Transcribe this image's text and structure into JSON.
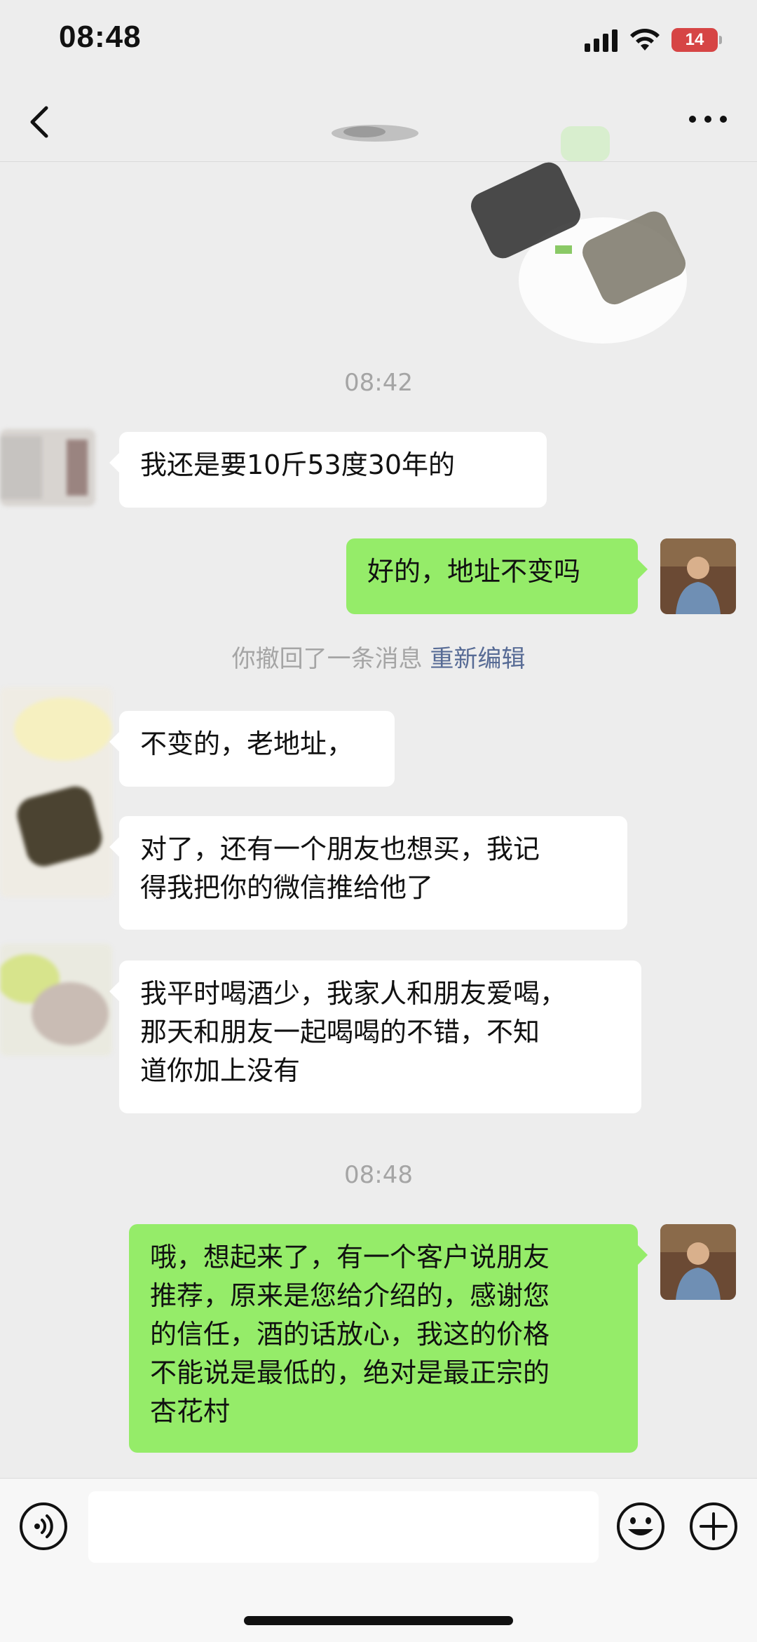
{
  "status_bar": {
    "time": "08:48",
    "battery": "14"
  },
  "icons": {
    "back": "chevron-left-icon",
    "more": "more-dots-icon",
    "voice": "voice-icon",
    "emoji": "emoji-icon",
    "plus": "plus-icon"
  },
  "colors": {
    "sent_bubble": "#95ec69",
    "received_bubble": "#ffffff",
    "link": "#576b95",
    "battery": "#d64545"
  },
  "messages": {
    "ts1": "08:42",
    "m1": "我还是要10斤53度30年的",
    "m2": "好的，地址不变吗",
    "recall_text": "你撤回了一条消息",
    "recall_link": "重新编辑",
    "m3": "不变的，老地址，",
    "m4": "对了，还有一个朋友也想买，我记\n得我把你的微信推给他了",
    "m5": "我平时喝酒少，我家人和朋友爱喝，\n那天和朋友一起喝喝的不错，不知\n道你加上没有",
    "ts2": "08:48",
    "m6": "哦，想起来了，有一个客户说朋友\n推荐，原来是您给介绍的，感谢您\n的信任，酒的话放心，我这的价格\n不能说是最低的，绝对是最正宗的\n杏花村"
  }
}
